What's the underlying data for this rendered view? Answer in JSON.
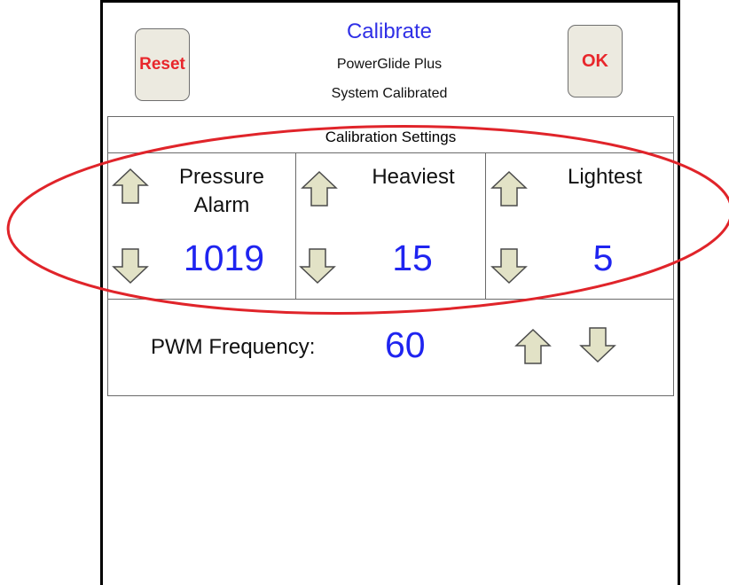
{
  "header": {
    "title": "Calibrate",
    "line1": "PowerGlide Plus",
    "line2": "System Calibrated",
    "reset_label": "Reset",
    "ok_label": "OK"
  },
  "settings": {
    "section_label": "Calibration Settings",
    "columns": [
      {
        "label_line1": "Pressure",
        "label_line2": "Alarm",
        "value": "1019"
      },
      {
        "label_line1": "Heaviest",
        "label_line2": "",
        "value": "15"
      },
      {
        "label_line1": "Lightest",
        "label_line2": "",
        "value": "5"
      }
    ]
  },
  "pwm": {
    "label": "PWM Frequency:",
    "value": "60"
  },
  "colors": {
    "accent_text": "#1f24f0",
    "button_text": "#e8262b",
    "annotation": "#e0242a",
    "arrow_fill": "#e2e2c6"
  }
}
